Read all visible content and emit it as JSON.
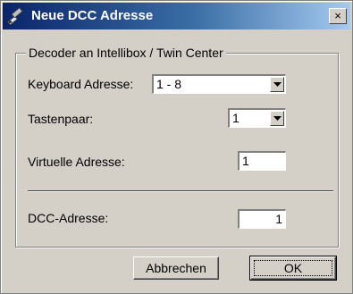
{
  "window": {
    "title": "Neue DCC Adresse",
    "close_label": "×"
  },
  "group": {
    "title": "Decoder an Intellibox / Twin Center"
  },
  "fields": {
    "keyboard_label": "Keyboard Adresse:",
    "keyboard_value": "1 - 8",
    "tastenpaar_label": "Tastenpaar:",
    "tastenpaar_value": "1",
    "virtuelle_label": "Virtuelle Adresse:",
    "virtuelle_value": "1",
    "dcc_label": "DCC-Adresse:",
    "dcc_value": "1"
  },
  "buttons": {
    "cancel_label": "Abbrechen",
    "ok_label": "OK"
  },
  "icons": {
    "title_icon": "pencil-icon",
    "dropdown_icon": "chevron-down-icon"
  }
}
